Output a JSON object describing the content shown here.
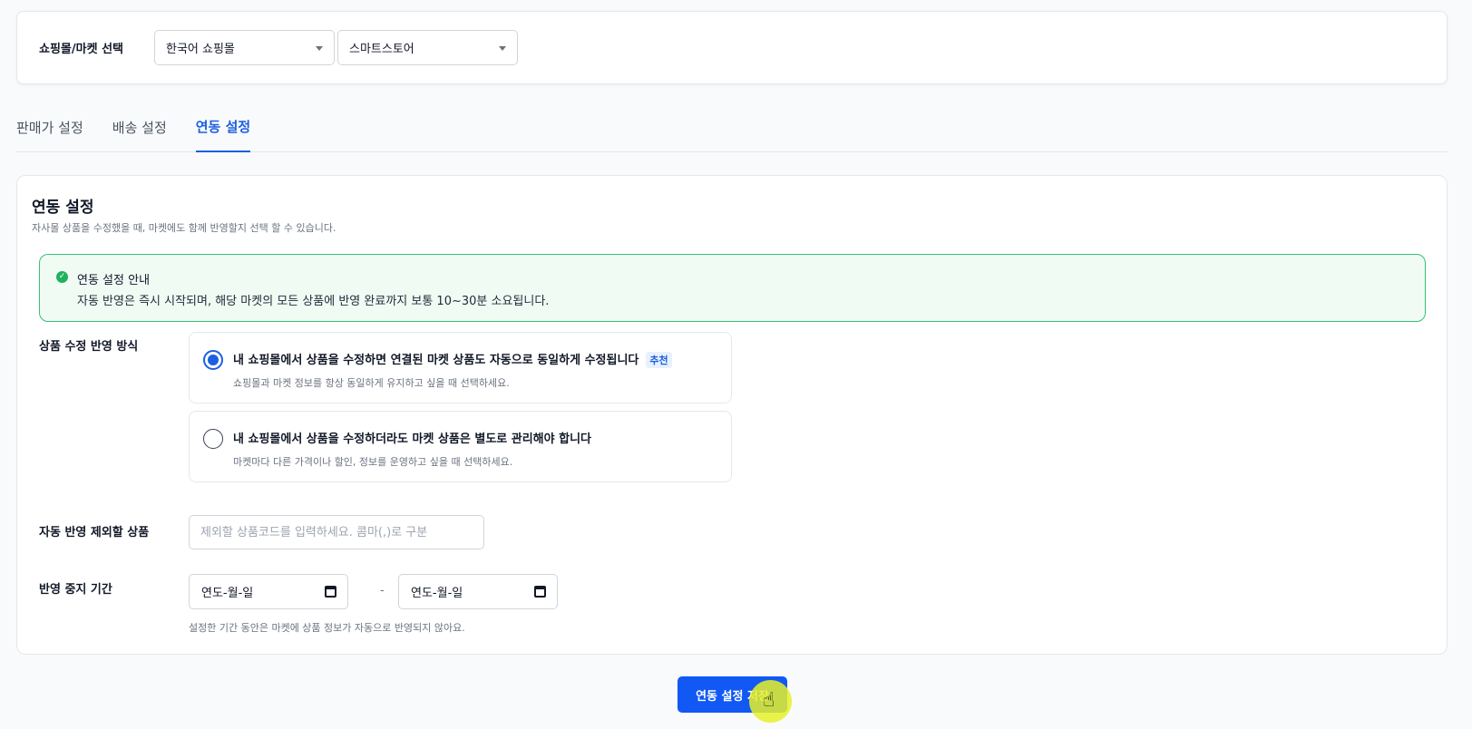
{
  "market_selector": {
    "label": "쇼핑몰/마켓 선택",
    "shop_select": "한국어 쇼핑몰",
    "market_select": "스마트스토어"
  },
  "tabs": [
    {
      "label": "판매가 설정",
      "active": false
    },
    {
      "label": "배송 설정",
      "active": false
    },
    {
      "label": "연동 설정",
      "active": true
    }
  ],
  "panel": {
    "title": "연동 설정",
    "description": "자사몰 상품을 수정했을 때, 마켓에도 함께 반영할지 선택 할 수 있습니다."
  },
  "notice": {
    "icon": "check-circle-icon",
    "title": "연동 설정 안내",
    "body": "자동 반영은 즉시 시작되며, 해당 마켓의 모든 상품에 반영 완료까지 보통 10~30분 소요됩니다."
  },
  "reflect_mode": {
    "label": "상품 수정 반영 방식",
    "options": [
      {
        "title": "내 쇼핑몰에서 상품을 수정하면 연결된 마켓 상품도 자동으로 동일하게 수정됩니다",
        "badge": "추천",
        "description": "쇼핑몰과 마켓 정보를 항상 동일하게 유지하고 싶을 때 선택하세요.",
        "selected": true
      },
      {
        "title": "내 쇼핑몰에서 상품을 수정하더라도 마켓 상품은 별도로 관리해야 합니다",
        "badge": "",
        "description": "마켓마다 다른 가격이나 할인, 정보를 운영하고 싶을 때 선택하세요.",
        "selected": false
      }
    ]
  },
  "exclude": {
    "label": "자동 반영 제외할 상품",
    "placeholder": "제외할 상품코드를 입력하세요. 콤마(,)로 구분",
    "value": ""
  },
  "pause_period": {
    "label": "반영 중지 기간",
    "start_placeholder": "연도-월-일",
    "end_placeholder": "연도-월-일",
    "separator": "-",
    "help": "설정한 기간 동안은 마켓에 상품 정보가 자동으로 반영되지 않아요."
  },
  "save_button": "연동 설정 저장",
  "colors": {
    "primary": "#1158f5",
    "tab_active": "#1d5fe0",
    "notice_border": "#37c072",
    "notice_bg": "#f0fbf4"
  }
}
